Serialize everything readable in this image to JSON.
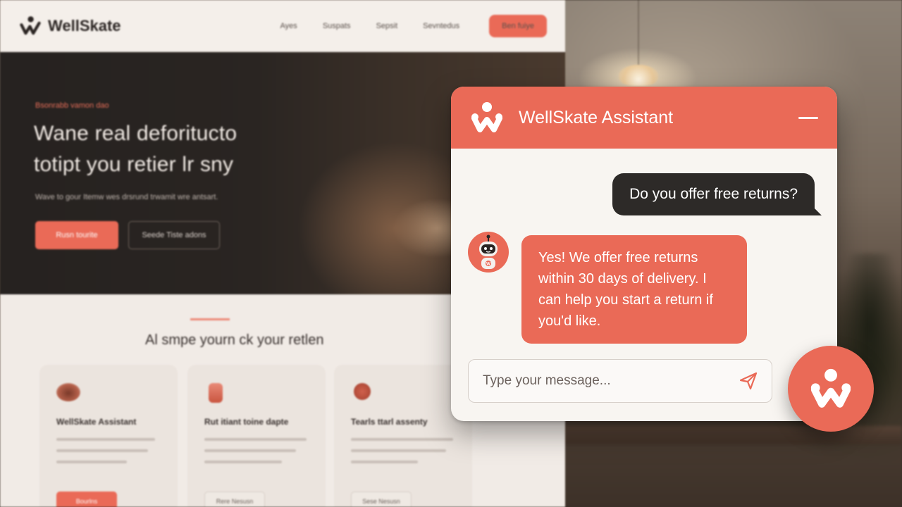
{
  "colors": {
    "accent": "#ea6a57",
    "dark_bubble": "#2d2a28",
    "panel_background": "#f8f5f1"
  },
  "website": {
    "brand": "WellSkate",
    "nav": [
      "Ayes",
      "Suspats",
      "Sepsit",
      "Sevntedus"
    ],
    "cta": "Ben fuiye",
    "hero": {
      "eyebrow": "Bsonrabb vamon dao",
      "title": "Wane real deforitucto totipt you retier lr sny",
      "subtitle": "Wave to gour Itemw wes drsrund trwamit wre antsart.",
      "primary_button": "Rusn tourite",
      "secondary_button": "Seede Tiste adons"
    },
    "section": {
      "title": "Al smpe yourn ck your retlen",
      "cards": [
        {
          "title": "WellSkate Assistant",
          "button": "Bourlns"
        },
        {
          "title": "Rut itiant toine dapte",
          "button": "Rere Nesusn"
        },
        {
          "title": "Tearls ttarl assenty",
          "button": "Sese Nesusn"
        }
      ]
    }
  },
  "chat": {
    "title": "WellSkate Assistant",
    "minimize_icon": "minimize-icon",
    "messages": [
      {
        "role": "user",
        "text": "Do you offer free returns?"
      },
      {
        "role": "assistant",
        "text": "Yes! We offer free returns within 30 days of delivery. I can help you start a return if you'd like."
      }
    ],
    "input_placeholder": "Type your message...",
    "input_value": "",
    "send_icon": "send-icon",
    "launcher_icon": "wellskate-logo-icon"
  }
}
